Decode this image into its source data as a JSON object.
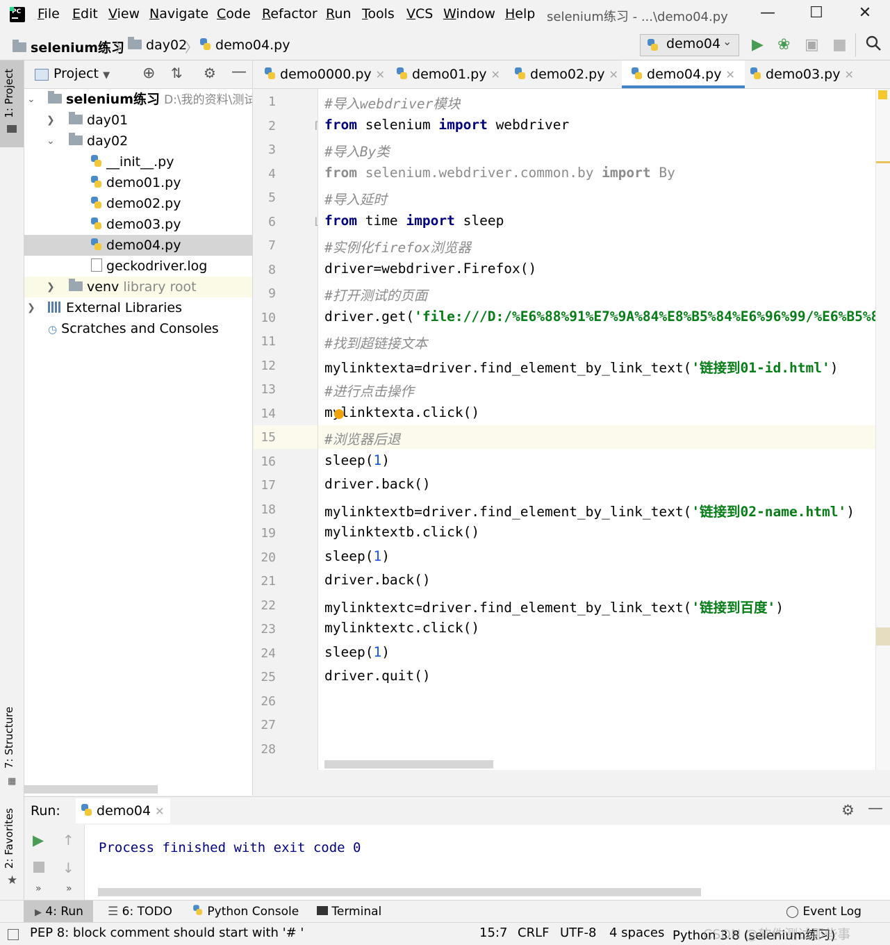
{
  "menu": {
    "items": [
      {
        "label": "File",
        "u": "F",
        "rest": "ile"
      },
      {
        "label": "Edit",
        "u": "E",
        "rest": "dit"
      },
      {
        "label": "View",
        "u": "V",
        "rest": "iew"
      },
      {
        "label": "Navigate",
        "u": "N",
        "rest": "avigate"
      },
      {
        "label": "Code",
        "u": "C",
        "rest": "ode"
      },
      {
        "label": "Refactor",
        "u": "R",
        "rest": "efactor"
      },
      {
        "label": "Run",
        "u": "R",
        "rest": "un"
      },
      {
        "label": "Tools",
        "u": "T",
        "rest": "ools"
      },
      {
        "label": "VCS",
        "u": "V",
        "rest": "CS"
      },
      {
        "label": "Window",
        "u": "W",
        "rest": "indow"
      },
      {
        "label": "Help",
        "u": "H",
        "rest": "elp"
      }
    ],
    "window_title": "selenium练习 - ...\\demo04.py"
  },
  "nav": {
    "crumb_project": "selenium练习",
    "crumb_folder": "day02",
    "crumb_file": "demo04.py",
    "run_config": "demo04"
  },
  "left_stripe": {
    "project_tab": "1: Project",
    "structure_tab": "7: Structure",
    "favorites_tab": "2: Favorites"
  },
  "project": {
    "title": "Project",
    "root_name": "selenium练习",
    "root_path": "D:\\我的资料\\测试",
    "day01": "day01",
    "day02": "day02",
    "files": [
      "__init__.py",
      "demo01.py",
      "demo02.py",
      "demo03.py",
      "demo04.py"
    ],
    "log_file": "geckodriver.log",
    "venv": "venv",
    "venv_note": "library root",
    "external_libraries": "External Libraries",
    "scratches": "Scratches and Consoles"
  },
  "tabs": [
    "demo0000.py",
    "demo01.py",
    "demo02.py",
    "demo04.py",
    "demo03.py"
  ],
  "editor": {
    "line_numbers": [
      "1",
      "2",
      "3",
      "4",
      "5",
      "6",
      "7",
      "8",
      "9",
      "10",
      "11",
      "12",
      "13",
      "14",
      "15",
      "16",
      "17",
      "18",
      "19",
      "20",
      "21",
      "22",
      "23",
      "24",
      "25",
      "26",
      "27",
      "28"
    ],
    "lines": {
      "l1": "#导入webdriver模块",
      "l2_kw1": "from",
      "l2_mod": " selenium ",
      "l2_kw2": "import",
      "l2_name": " webdriver",
      "l3": "#导入By类",
      "l4_kw1": "from",
      "l4_mod": " selenium.webdriver.common.by ",
      "l4_kw2": "import",
      "l4_name": " By",
      "l5": "#导入延时",
      "l6_kw1": "from",
      "l6_mod": " time ",
      "l6_kw2": "import",
      "l6_name": " sleep",
      "l7": "#实例化firefox浏览器",
      "l8": "driver=webdriver.Firefox()",
      "l9": "#打开测试的页面",
      "l10_a": "driver.get(",
      "l10_s": "'file:///D:/%E6%88%91%E7%9A%84%E8%B5%84%E6%96%99/%E6%B5%8B",
      "l11": "#找到超链接文本",
      "l12_a": "mylinktexta=driver.find_element_by_link_text(",
      "l12_s": "'链接到01-id.html'",
      "l12_b": ")",
      "l13": "#进行点击操作",
      "l14": "mylinktexta.click()",
      "l15": "#浏览器后退",
      "l16_a": "sleep(",
      "l16_n": "1",
      "l16_b": ")",
      "l17": "driver.back()",
      "l18_a": "mylinktextb=driver.find_element_by_link_text(",
      "l18_s": "'链接到02-name.html'",
      "l18_b": ")",
      "l19": "mylinktextb.click()",
      "l20_a": "sleep(",
      "l20_n": "1",
      "l20_b": ")",
      "l21": "driver.back()",
      "l22_a": "mylinktextc=driver.find_element_by_link_text(",
      "l22_s": "'链接到百度'",
      "l22_b": ")",
      "l23": "mylinktextc.click()",
      "l24_a": "sleep(",
      "l24_n": "1",
      "l24_b": ")",
      "l25": "driver.quit()"
    }
  },
  "run": {
    "label": "Run:",
    "tab": "demo04",
    "output": "Process finished with exit code 0"
  },
  "bottom_tabs": {
    "run": "4: Run",
    "todo": "6: TODO",
    "python_console": "Python Console",
    "terminal": "Terminal",
    "event_log": "Event Log"
  },
  "status": {
    "message": "PEP 8: block comment should start with '# '",
    "position": "15:7",
    "line_sep": "CRLF",
    "encoding": "UTF-8",
    "indent": "4 spaces",
    "interpreter": "Python 3.8 (selenium练习)",
    "watermark": "CSDN @软件测试那些事"
  },
  "colors": {
    "accent": "#4083c9",
    "run_green": "#499c54",
    "keyword": "#000080",
    "string": "#067d17",
    "comment": "#8c8c8c",
    "highlight_line": "#fcfaed"
  }
}
